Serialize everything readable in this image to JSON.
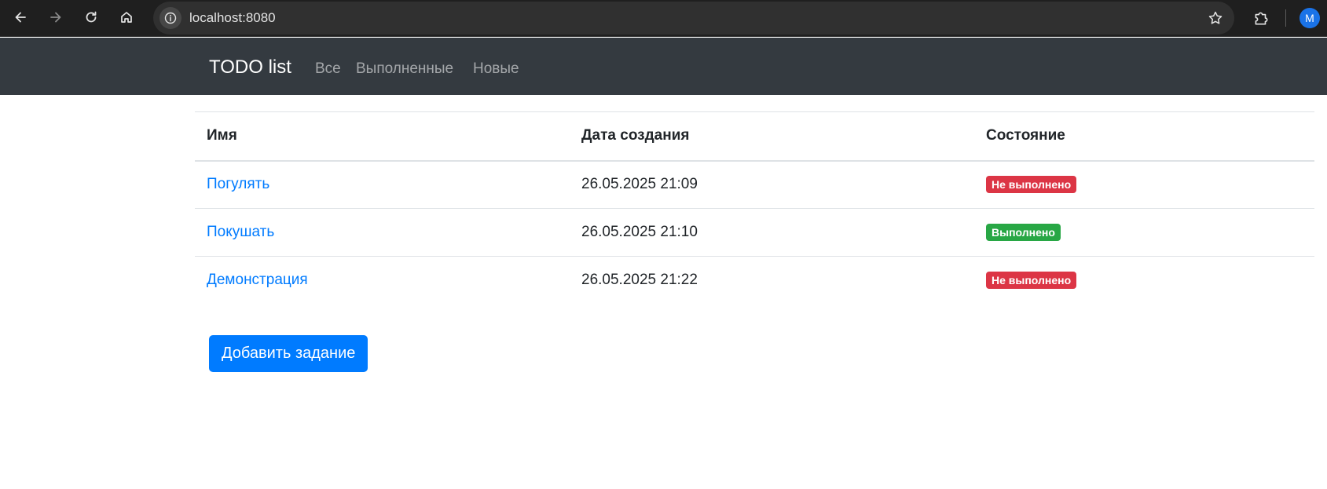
{
  "browser": {
    "url": "localhost:8080",
    "profile_initial": "M",
    "icons": [
      "back-icon",
      "forward-icon",
      "reload-icon",
      "home-icon",
      "site-info-icon",
      "bookmark-star-icon",
      "extensions-icon"
    ]
  },
  "navbar": {
    "brand": "TODO list",
    "links": [
      {
        "label": "Все"
      },
      {
        "label": "Выполненные"
      },
      {
        "label": "Новые"
      }
    ]
  },
  "table": {
    "headers": {
      "name": "Имя",
      "date": "Дата создания",
      "status": "Состояние"
    },
    "rows": [
      {
        "name": "Погулять",
        "date": "26.05.2025 21:09",
        "status": "Не выполнено",
        "status_color": "#dc3545"
      },
      {
        "name": "Покушать",
        "date": "26.05.2025 21:10",
        "status": "Выполнено",
        "status_color": "#28a745"
      },
      {
        "name": "Демонстрация",
        "date": "26.05.2025 21:22",
        "status": "Не выполнено",
        "status_color": "#dc3545"
      }
    ]
  },
  "actions": {
    "add_label": "Добавить задание"
  },
  "colors": {
    "navbar_bg": "#343a40",
    "link": "#007bff",
    "primary_button": "#007bff",
    "danger": "#dc3545",
    "success": "#28a745"
  }
}
